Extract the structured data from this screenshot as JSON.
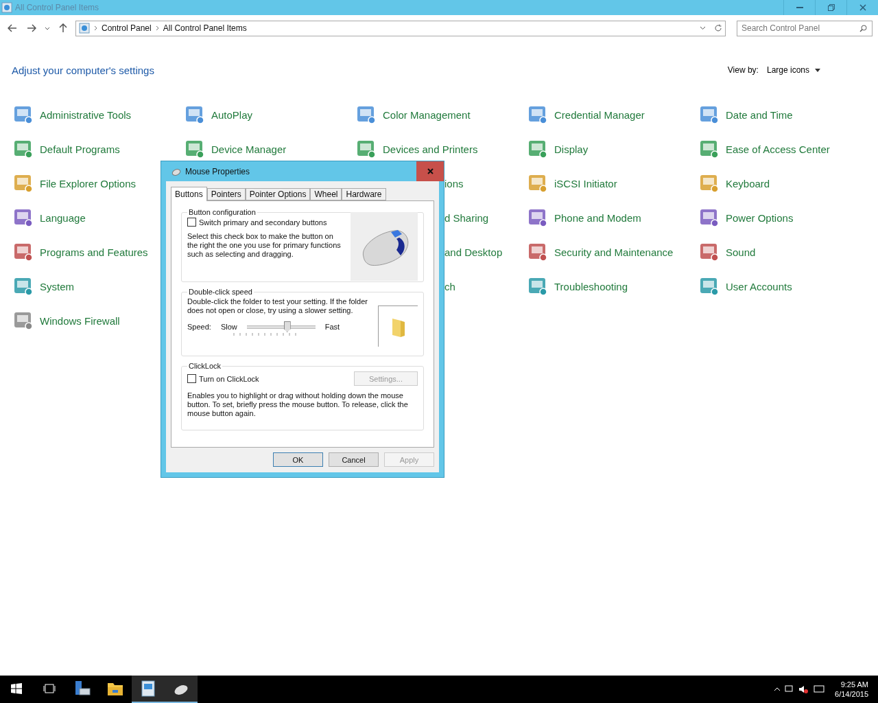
{
  "window": {
    "title": "All Control Panel Items"
  },
  "address_bar": {
    "path": [
      "Control Panel",
      "All Control Panel Items"
    ]
  },
  "search": {
    "placeholder": "Search Control Panel"
  },
  "heading": "Adjust your computer's settings",
  "view_by": {
    "label": "View by:",
    "value": "Large icons"
  },
  "columns": [
    {
      "items": [
        {
          "kind": "full",
          "label": "Administrative Tools"
        },
        {
          "kind": "full",
          "label": "Default Programs"
        },
        {
          "kind": "full",
          "label": "File Explorer Options"
        },
        {
          "kind": "full",
          "label": "Language"
        },
        {
          "kind": "full",
          "label": "Programs and Features"
        },
        {
          "kind": "full",
          "label": "System"
        },
        {
          "kind": "full",
          "label": "Windows Firewall"
        }
      ]
    },
    {
      "items": [
        {
          "kind": "full",
          "label": "AutoPlay"
        },
        {
          "kind": "full",
          "label": "Device Manager"
        }
      ]
    },
    {
      "items": [
        {
          "kind": "full",
          "label": "Color Management"
        },
        {
          "kind": "full",
          "label": "Devices and Printers"
        },
        {
          "kind": "partial",
          "label": "ions"
        },
        {
          "kind": "partial",
          "label": "d Sharing"
        },
        {
          "kind": "partial",
          "label": "and Desktop"
        },
        {
          "kind": "partial",
          "label": "ch"
        }
      ]
    },
    {
      "items": [
        {
          "kind": "full",
          "label": "Credential Manager"
        },
        {
          "kind": "full",
          "label": "Display"
        },
        {
          "kind": "full",
          "label": "iSCSI Initiator"
        },
        {
          "kind": "full",
          "label": "Phone and Modem"
        },
        {
          "kind": "full",
          "label": "Security and Maintenance"
        },
        {
          "kind": "full",
          "label": "Troubleshooting"
        }
      ]
    },
    {
      "items": [
        {
          "kind": "full",
          "label": "Date and Time"
        },
        {
          "kind": "full",
          "label": "Ease of Access Center"
        },
        {
          "kind": "full",
          "label": "Keyboard"
        },
        {
          "kind": "full",
          "label": "Power Options"
        },
        {
          "kind": "full",
          "label": "Sound"
        },
        {
          "kind": "full",
          "label": "User Accounts"
        }
      ]
    }
  ],
  "dialog": {
    "title": "Mouse Properties",
    "tabs": [
      {
        "label": "Buttons",
        "selected": true
      },
      {
        "label": "Pointers",
        "selected": false
      },
      {
        "label": "Pointer Options",
        "selected": false
      },
      {
        "label": "Wheel",
        "selected": false
      },
      {
        "label": "Hardware",
        "selected": false
      }
    ],
    "button_configuration": {
      "title": "Button configuration",
      "checkbox": {
        "label": "Switch primary and secondary buttons",
        "checked": false
      },
      "description": "Select this check box to make the button on the right the one you use for primary functions such as selecting and dragging."
    },
    "double_click": {
      "title": "Double-click speed",
      "description": "Double-click the folder to test your setting. If the folder does not open or close, try using a slower setting.",
      "speed_label": "Speed:",
      "slow": "Slow",
      "fast": "Fast",
      "level": 0.59
    },
    "clicklock": {
      "title": "ClickLock",
      "checkbox": {
        "label": "Turn on ClickLock",
        "checked": false
      },
      "settings_button": {
        "label": "Settings...",
        "disabled": true
      },
      "description": "Enables you to highlight or drag without holding down the mouse button. To set, briefly press the mouse button. To release, click the mouse button again."
    },
    "buttons": [
      {
        "label": "OK",
        "disabled": false,
        "default": true
      },
      {
        "label": "Cancel",
        "disabled": false,
        "default": false
      },
      {
        "label": "Apply",
        "disabled": true,
        "default": false
      }
    ]
  },
  "taskbar": {
    "items": [
      {
        "kind": "start",
        "active": false
      },
      {
        "kind": "taskview",
        "active": false
      },
      {
        "kind": "server",
        "active": false
      },
      {
        "kind": "folder",
        "active": false
      },
      {
        "kind": "panel",
        "active": true
      },
      {
        "kind": "mouse",
        "active": true
      }
    ],
    "time": "9:25 AM",
    "date": "6/14/2015"
  }
}
